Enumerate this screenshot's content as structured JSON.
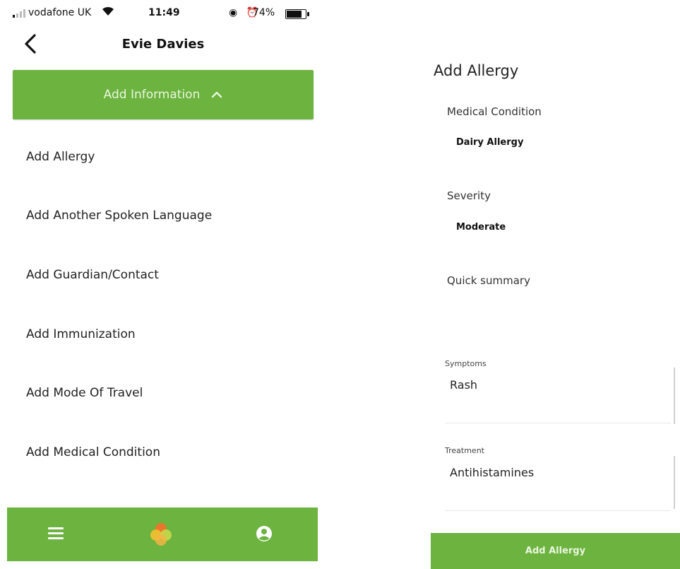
{
  "status_bar": {
    "carrier": "vodafone UK",
    "time": "11:49",
    "battery_pct": "74%"
  },
  "header": {
    "title": "Evie Davies"
  },
  "add_info": {
    "label": "Add Information"
  },
  "menu_items": [
    "Add Allergy",
    "Add Another Spoken Language",
    "Add Guardian/Contact",
    "Add Immunization",
    "Add Mode Of Travel",
    "Add Medical Condition"
  ],
  "colors": {
    "accent_green": "#6cb33f"
  },
  "icons": {
    "back": "chevron-left-icon",
    "add_info_toggle": "chevron-up-icon",
    "bottom_left": "hamburger-menu-icon",
    "bottom_center": "app-logo-icon",
    "bottom_right": "user-account-icon"
  },
  "form": {
    "title": "Add Allergy",
    "medical_condition_label": "Medical Condition",
    "medical_condition_value": "Dairy Allergy",
    "severity_label": "Severity",
    "severity_value": "Moderate",
    "quick_summary_label": "Quick summary",
    "symptoms_label": "Symptoms",
    "symptoms_value": "Rash",
    "treatment_label": "Treatment",
    "treatment_value": "Antihistamines",
    "submit_label": "Add Allergy"
  }
}
